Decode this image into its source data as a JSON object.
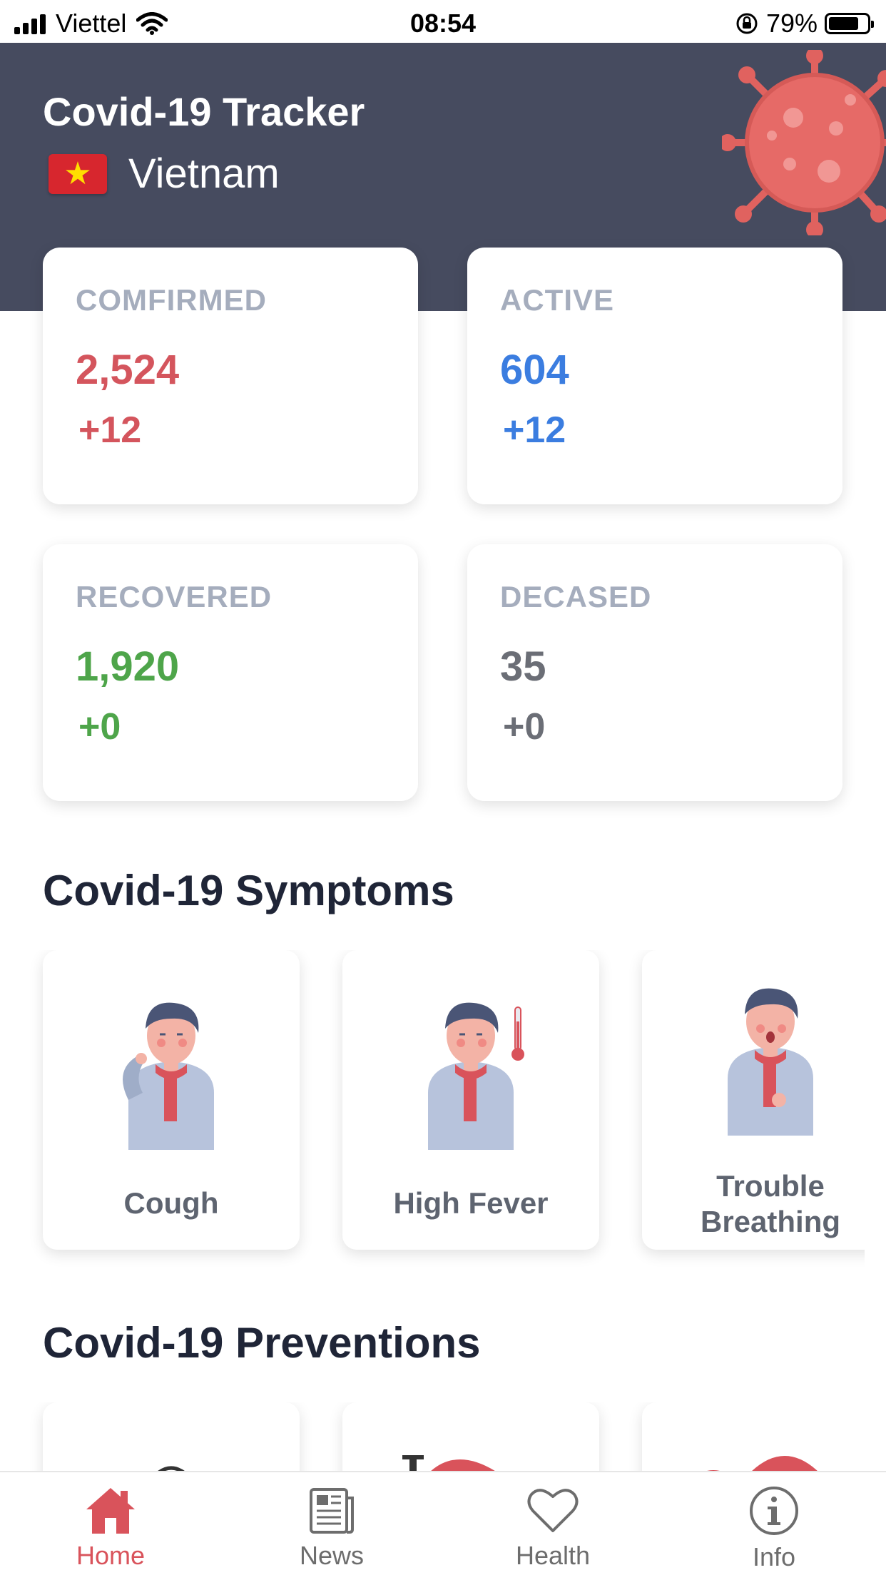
{
  "status_bar": {
    "carrier": "Viettel",
    "time": "08:54",
    "battery": "79%"
  },
  "header": {
    "title": "Covid-19 Tracker",
    "country": "Vietnam"
  },
  "stats": [
    {
      "label": "COMFIRMED",
      "value": "2,524",
      "delta": "+12",
      "color": "#d4555d"
    },
    {
      "label": "ACTIVE",
      "value": "604",
      "delta": "+12",
      "color": "#3b7de0"
    },
    {
      "label": "RECOVERED",
      "value": "1,920",
      "delta": "+0",
      "color": "#4ea54a"
    },
    {
      "label": "DECASED",
      "value": "35",
      "delta": "+0",
      "color": "#6b6e76"
    }
  ],
  "symptoms": {
    "title": "Covid-19 Symptoms",
    "items": [
      "Cough",
      "High Fever",
      "Trouble Breathing"
    ]
  },
  "preventions": {
    "title": "Covid-19 Preventions"
  },
  "tabbar": {
    "items": [
      {
        "label": "Home",
        "icon": "home-icon",
        "active": true
      },
      {
        "label": "News",
        "icon": "news-icon",
        "active": false
      },
      {
        "label": "Health",
        "icon": "heart-icon",
        "active": false
      },
      {
        "label": "Info",
        "icon": "info-icon",
        "active": false
      }
    ],
    "active_color": "#d9535b",
    "inactive_color": "#6d6d6d"
  }
}
